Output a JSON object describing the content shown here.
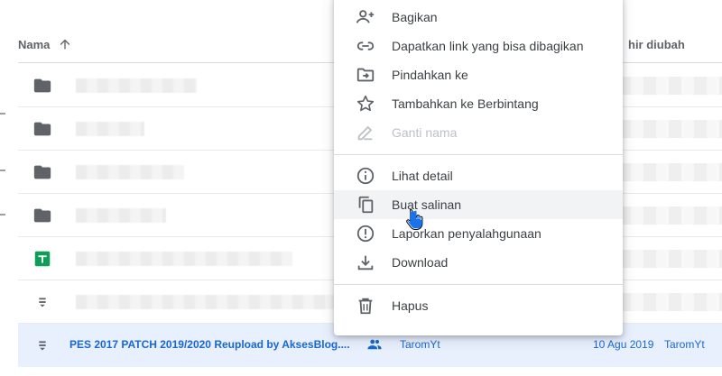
{
  "list": {
    "header": {
      "name_label": "Nama",
      "modified_label": "hir diubah"
    },
    "selected_file": {
      "name": "PES 2017 PATCH 2019/2020 Reupload by AksesBlog....",
      "owner": "TaromYt",
      "date": "10 Agu 2019",
      "modified_by": "TaromYt"
    }
  },
  "menu": {
    "items": [
      {
        "label": "Bagikan",
        "icon": "person-add-icon"
      },
      {
        "label": "Dapatkan link yang bisa dibagikan",
        "icon": "link-icon"
      },
      {
        "label": "Pindahkan ke",
        "icon": "move-to-folder-icon"
      },
      {
        "label": "Tambahkan ke Berbintang",
        "icon": "star-icon"
      },
      {
        "label": "Ganti nama",
        "icon": "pencil-icon"
      },
      {
        "label": "Lihat detail",
        "icon": "info-icon"
      },
      {
        "label": "Buat salinan",
        "icon": "copy-icon"
      },
      {
        "label": "Laporkan penyalahgunaan",
        "icon": "report-icon"
      },
      {
        "label": "Download",
        "icon": "download-icon"
      },
      {
        "label": "Hapus",
        "icon": "trash-icon"
      }
    ]
  },
  "colors": {
    "accent": "#1967d2",
    "selected_bg": "#e8f0fe",
    "sheets_green": "#0f9d58"
  }
}
